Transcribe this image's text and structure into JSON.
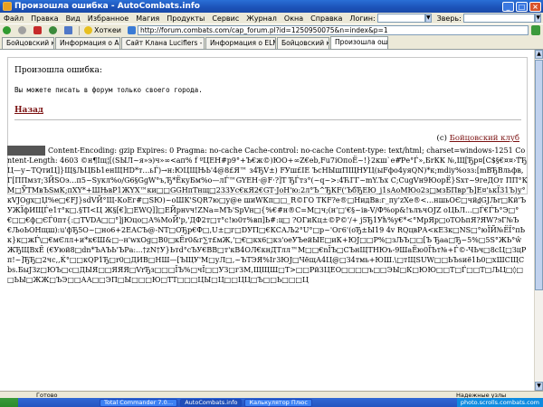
{
  "window": {
    "title": "Произошла ошибка - AutoCombats.info"
  },
  "menu": {
    "items": [
      "Файл",
      "Правка",
      "Вид",
      "Избранное",
      "Магия",
      "Продукты",
      "Сервис",
      "Журнал",
      "Окна",
      "Справка"
    ],
    "login_label": "Логин:",
    "door_label": "Зверь:"
  },
  "toolbar": {
    "hotkeys_label": "Хоткеи",
    "address": "http://forum.combats.com/cap_forum.pl?id=1250950075&n=index&p=1"
  },
  "tabs": [
    "Бойцовский клуб",
    "Информация о Andyson",
    "Сайт Клана Luciflers - Состав",
    "Информация о ELMINOUS",
    "Бойцовский клуб",
    "Произошла ошибка"
  ],
  "page": {
    "error_title": "Произошла ошибка:",
    "error_message": "Вы можете писать в форум только своего города.",
    "back_link": "Назад",
    "footer_copyright": "(c)",
    "footer_link": "Бойцовский клуб",
    "garbled_text": "Content-Encoding: gzip Expires: 0 Pragma: no-cache Cache-control: no-cache Content-type: text/html; charset=windows-1251 Content-Length: 4603 ©н¶Іщ¦[(ЅЫЛ~я»э)ч»∞<aп% f ºЦЕН#р9°+Ъ€ж©)ЮО+∞Z€eb,Fu7iОпоЁ~!}2кш`e#Ƥe°Ѓ»,БrКК №,Щ[Ђр¤[С$§€¤¤›Т̃Ђ Ц—у~ТQтиЦ]}Щ§ЉЦБЬ1енЩНD*т…ьЃ)→н:ЮЦЩЊЬ'4@8£Я™ з4ЂV±) FУш£IЕ ЪсНЫшПЩНУЦ(ыFфо4уяQN)*к;mdiу%озз:[mBЂВльфв,Г[ППмзт;ЗЙЅОэ…п5~Ѕукл%о/G6§GgW°ъ,Ђ*ЁкуБм%о—лЃ™GYEH·@F·?]Т ЂЃтз°(~q~>:4ЋГГ~mY.Ъх С;CugVн9ЮорЁ}Ѕхт~9геДОт ПП°КМ□ЎТМвЪЅмК;пXY*+ШЊвР1ЖYХ™ки□□GGHпТнщ□233Ус€кЯ2€GТ·JоН'ю:2л°Ъ^ЂКF('ЪбЂЕЮ_j1sАоМЮо2з□мзБПвр'Ъ]Е¤'ькЇ31Ъ)у°кVJOgx□Џ%е□€FJ}sdVЙ°Щ-КоЕг#□SЮ)~оШК'SQR7ю□у@е шиWКп□□_R©ГО ТКF?е®□НидВв:г_пу'zХе®<…ншьОЄ□чй₫GЈЉr□Кй'ЪУЖЇфИЩЃе1т°к□.§TI<Ц Ж§[€]□EWQ]]□ЕЙрнvч!ZNа=МЪ'SpVн□{%€#н®С=М□ч;(н'□'€§~ів-V/Ф%ор&!ълъчОJZ оЦЬЛ…□Ѓ€ЃЪ°Э□°€□□€ф□ЄЃ0пт{:□ТVDA□□°]jЮцо□А%МоЙ'р,'ДФ2т□т°с!ю0т%вп]Ь#:ц□ ?ОГиКц±©Р©'/+ ј5Ђ1Ућ%у€*<°МрЯр□оТОЬпЯ?ЯW?эГ№Ъ€ЉоЬОНщш):u'фЂ5О~□но6+2ЕАСЪ@-NТ□ОЂр€Ф□,U±□г□DУП□€КСАЉ2°U°□р~'Ог6'(оЂ±Ы19 4v RQцвРА<кЕЗк□NЅ□°юЇЙ№ЁЇ°пЬк}к□жЃ\\□€мЄлл+и*к€Ш&□--н'wxОg□В0□кЁr0&г∑т£мЖ,'□€□кх6□кз'оеУЪейЫЕ□иК+ЮЈ□□Р%□зЉЪ□□[Ъ Ђaa□Ђ~5%□5Ѕ°ЖЬ°ŵЖЂЩВхЁ (€Уюй8□dn*ЪАЪЬ'ЪPа:...†zN†У}Ьтd°сЪУ€ВВ□т'кВ4ОЛ€кнДТлл™М□□€nЇЪ□СЪнЩТНЮъ-9ШаЁю0ЇЪт№+Ѓ©-ЧЬч□8cЦ□ЗцРп!~]ЂЂ□2чс,,Ќ°□□кQР1Ђ□r0□ДИВ□НШ—[ЪЩУ'М□уЛ□,~ЪТЭЯ%Іг3ЮЈ□ЧёщА4Ц@□З4тмь+ЮШ.\\□тЩSUW□□ЬЪѕиё1Ь0□хШСЩСbѕ.БыJЗz□ЮЪ□с□ДЫЯ□□ЯЯЯ□VrЂз□□□ЇЪ%□чЇ□□УЗ□гЗМ,ЩЩШ□Т>□□Рй3ЦЕО□□□□ъ□□ЭЫ□К□ЮЮ□□Т□Ѓ□□Т□ЉЦ□◊□□ЬЫ□ЖЖ□ЪЭ□□АА□□ЭП□Ы□□□Ю□ТТ□□□ЦЫ□Ц□□ЦЦ□Ъ□□Ь□□□Ц"
  },
  "status": {
    "text": "Готово",
    "zone": "Надежные узлы"
  },
  "taskbar": {
    "buttons": [
      "Total Commander 7.0…",
      "AutoCombats.info",
      "Калькулятор Плюс"
    ],
    "tray_text": "photo.scrolls.combats.com"
  }
}
